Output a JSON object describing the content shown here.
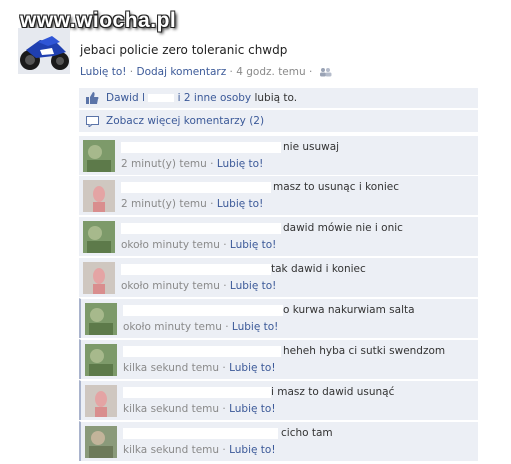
{
  "watermark": "www.wiocha.pl",
  "post": {
    "text": "jebaci policie zero toleranic chwdp",
    "like_label": "Lubię to!",
    "comment_label": "Dodaj komentarz",
    "time": "4 godz. temu",
    "dot": "·",
    "audience_icon": "friends-icon"
  },
  "likes": {
    "name": "Dawid l",
    "others": "i 2 inne osoby",
    "suffix": "lubią to.",
    "icon": "thumbs-up-icon"
  },
  "more_comments": {
    "label": "Zobacz więcej komentarzy (2)",
    "icon": "speech-bubble-icon"
  },
  "comments": [
    {
      "text": "nie usuwaj",
      "time": "2 minut(y) temu",
      "like": "Lubię to!",
      "avatar": "green"
    },
    {
      "text": "masz to usunąc i koniec",
      "time": "2 minut(y) temu",
      "like": "Lubię to!",
      "avatar": "pink"
    },
    {
      "text": "dawid mówie nie i onic",
      "time": "około minuty temu",
      "like": "Lubię to!",
      "avatar": "green"
    },
    {
      "text": "tak dawid i koniec",
      "time": "około minuty temu",
      "like": "Lubię to!",
      "avatar": "pink"
    },
    {
      "text": "o kurwa nakurwiam salta",
      "time": "około minuty temu",
      "like": "Lubię to!",
      "avatar": "green"
    },
    {
      "text": "heheh hyba ci sutki swendzom",
      "time": "kilka sekund temu",
      "like": "Lubię to!",
      "avatar": "green"
    },
    {
      "text": "i masz to dawid usunąć",
      "time": "kilka sekund temu",
      "like": "Lubię to!",
      "avatar": "pink"
    },
    {
      "text": "cicho tam",
      "time": "kilka sekund temu",
      "like": "Lubię to!",
      "avatar": "green"
    }
  ],
  "colors": {
    "link": "#3b5998",
    "panel": "#eceff5",
    "meta": "#8a8a8a"
  }
}
